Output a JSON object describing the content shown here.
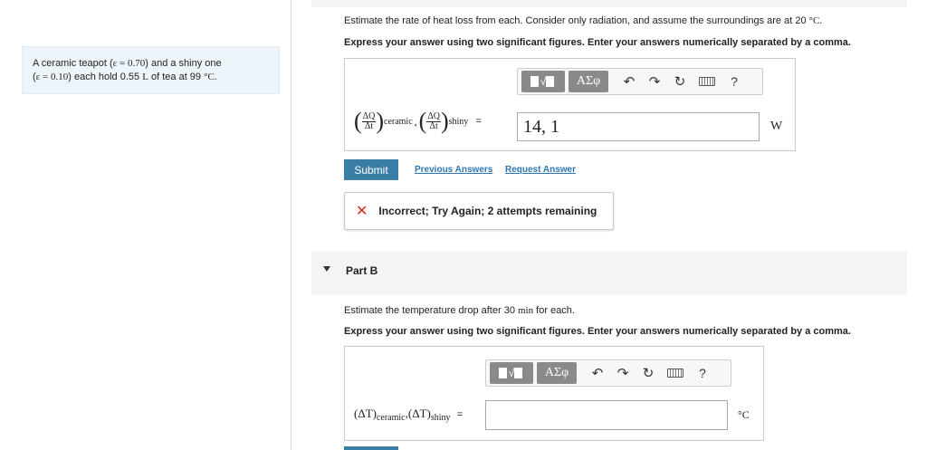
{
  "problem": {
    "line1_prefix": "A ceramic teapot (",
    "line1_eps": "ε = 0.70",
    "line1_suffix": ") and a shiny one",
    "line2_prefix": "(",
    "line2_eps": "ε = 0.10",
    "line2_mid": ") each hold 0.55 ",
    "line2_unit": "L",
    "line2_mid2": " of tea at 99 ",
    "line2_temp": "°C."
  },
  "partA": {
    "question_prefix": "Estimate the rate of heat loss from each. Consider only radiation, and assume the surroundings are at 20 ",
    "question_unit": "°C.",
    "instruction": "Express your answer using two significant figures. Enter your answers numerically separated by a comma.",
    "toolbar": {
      "symbols": "ΑΣφ",
      "help": "?"
    },
    "label": {
      "dq": "ΔQ",
      "dt": "Δt",
      "ceramic": "ceramic",
      "comma": ",",
      "shiny": "shiny",
      "equals": "="
    },
    "input_value": "14, 1",
    "unit": "W",
    "submit": "Submit",
    "previous_answers": "Previous Answers",
    "request_answer": "Request Answer",
    "feedback": "Incorrect; Try Again; 2 attempts remaining"
  },
  "partB": {
    "title": "Part B",
    "question_prefix": "Estimate the temperature drop after 30 ",
    "question_unit": "min",
    "question_suffix": " for each.",
    "instruction": "Express your answer using two significant figures. Enter your answers numerically separated by a comma.",
    "toolbar": {
      "symbols": "ΑΣφ",
      "help": "?"
    },
    "label": {
      "dT": "(ΔT)",
      "ceramic": "ceramic",
      "comma": ",",
      "shiny": "shiny",
      "equals": "="
    },
    "input_value": "",
    "unit": "°C"
  },
  "colors": {
    "accent": "#3a7ea6",
    "link": "#2d76b1",
    "error": "#d9271e",
    "panel": "#eef5fa"
  }
}
